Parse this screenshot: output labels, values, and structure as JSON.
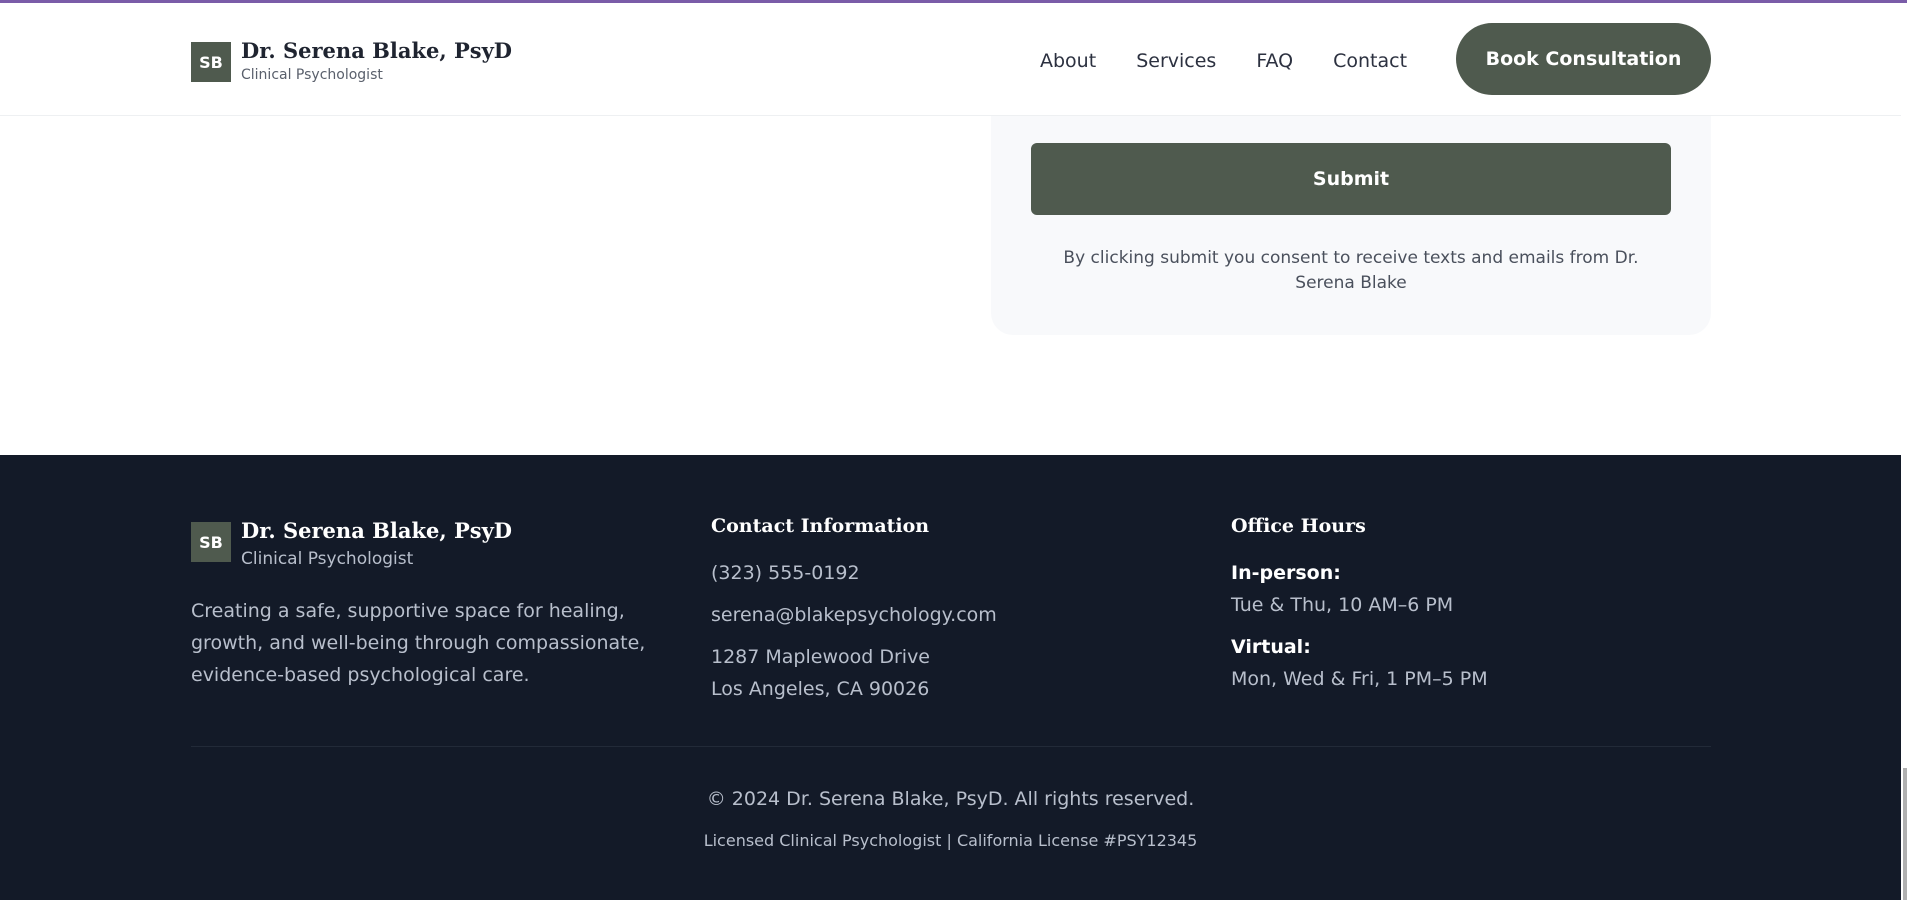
{
  "header": {
    "logo_initials": "SB",
    "name": "Dr. Serena Blake, PsyD",
    "subtitle": "Clinical Psychologist",
    "nav": [
      "About",
      "Services",
      "FAQ",
      "Contact"
    ],
    "cta": "Book Consultation"
  },
  "form": {
    "submit_label": "Submit",
    "consent": "By clicking submit you consent to receive texts and emails from Dr. Serena Blake"
  },
  "footer": {
    "logo_initials": "SB",
    "name": "Dr. Serena Blake, PsyD",
    "subtitle": "Clinical Psychologist",
    "description": "Creating a safe, supportive space for healing, growth, and well-being through compassionate, evidence-based psychological care.",
    "contact": {
      "title": "Contact Information",
      "phone": "(323) 555-0192",
      "email": "serena@blakepsychology.com",
      "address_line1": "1287 Maplewood Drive",
      "address_line2": "Los Angeles, CA 90026"
    },
    "hours": {
      "title": "Office Hours",
      "inperson_label": "In-person:",
      "inperson_value": "Tue & Thu, 10 AM–6 PM",
      "virtual_label": "Virtual:",
      "virtual_value": "Mon, Wed & Fri, 1 PM–5 PM"
    },
    "copyright": "© 2024 Dr. Serena Blake, PsyD. All rights reserved.",
    "license": "Licensed Clinical Psychologist | California License #PSY12345"
  },
  "colors": {
    "accent": "#4f5a4e",
    "footer_bg": "#131a28",
    "top_bar": "#7a5ca8"
  }
}
